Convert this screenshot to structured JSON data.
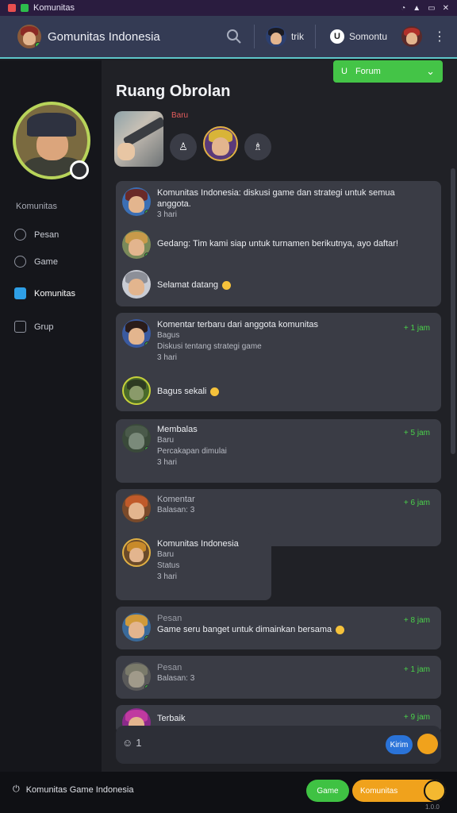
{
  "statusbar": {
    "app_label": "Komunitas"
  },
  "header": {
    "title": "Gomunitas Indonesia",
    "user1_name": "trik",
    "user2_name": "Somontu"
  },
  "sidebar": {
    "section_label": "Komunitas",
    "items": [
      {
        "label": "Pesan",
        "icon": "chat-icon"
      },
      {
        "label": "Game",
        "icon": "game-icon"
      },
      {
        "label": "Komunitas",
        "icon": "community-icon",
        "active": true
      },
      {
        "label": "Grup",
        "icon": "group-icon"
      }
    ]
  },
  "main": {
    "filter_label": "Forum",
    "room_title": "Ruang Obrolan",
    "story_label": "Baru",
    "messages": [
      {
        "text": "Komunitas Indonesia: diskusi game dan strategi untuk semua anggota.",
        "meta": "3 hari"
      },
      {
        "text": "Gedang: Tim kami siap untuk turnamen berikutnya, ayo daftar!",
        "meta": ""
      },
      {
        "text": "Selamat datang",
        "meta": ""
      },
      {
        "text": "Komentar terbaru dari anggota komunitas",
        "sub1": "Bagus",
        "sub2": "Diskusi tentang strategi game",
        "meta": "3 hari",
        "time": "+ 1 jam"
      },
      {
        "text": "Bagus sekali",
        "time": ""
      },
      {
        "text": "Membalas",
        "sub1": "Baru",
        "sub2": "Percakapan dimulai",
        "meta": "3 hari",
        "time": "+ 5 jam"
      },
      {
        "text": "Komentar",
        "sub1": "Balasan: 3",
        "time": "+ 6 jam"
      },
      {
        "text": "Komunitas Indonesia",
        "sub1": "Baru",
        "sub2": "Status",
        "meta": "3 hari"
      },
      {
        "text": "Pesan",
        "sub1": "Game seru banget untuk dimainkan bersama",
        "time": "+ 8 jam"
      },
      {
        "text": "Pesan",
        "sub1": "Balasan: 3",
        "time": "+ 1 jam"
      },
      {
        "text": "Terbaik",
        "time": "+ 9 jam"
      }
    ]
  },
  "composer": {
    "count": "1",
    "send_label": "Kirim"
  },
  "bottombar": {
    "info_text": "Komunitas Game Indonesia",
    "btn_green": "Game",
    "btn_yellow": "Komunitas",
    "version": "1.0.0"
  }
}
